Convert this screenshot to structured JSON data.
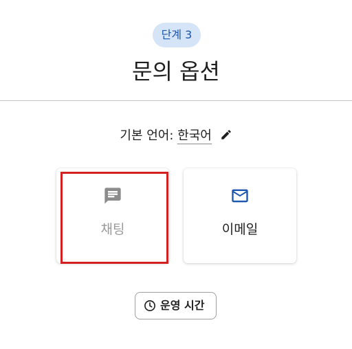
{
  "header": {
    "step_label": "단계 3",
    "title": "문의 옵션"
  },
  "language": {
    "prefix": "기본 언어:",
    "value": "한국어",
    "edit_icon": "pencil-icon"
  },
  "options": [
    {
      "label": "채팅",
      "icon": "chat-icon",
      "state": "disabled"
    },
    {
      "label": "이메일",
      "icon": "mail-icon",
      "state": "enabled"
    }
  ],
  "hours_button": {
    "label": "운영 시간",
    "icon": "clock-icon"
  },
  "colors": {
    "accent": "#1a56b0",
    "badge_bg": "#d6e4f7",
    "highlight": "#d32020",
    "disabled_text": "#9a9a9a"
  }
}
